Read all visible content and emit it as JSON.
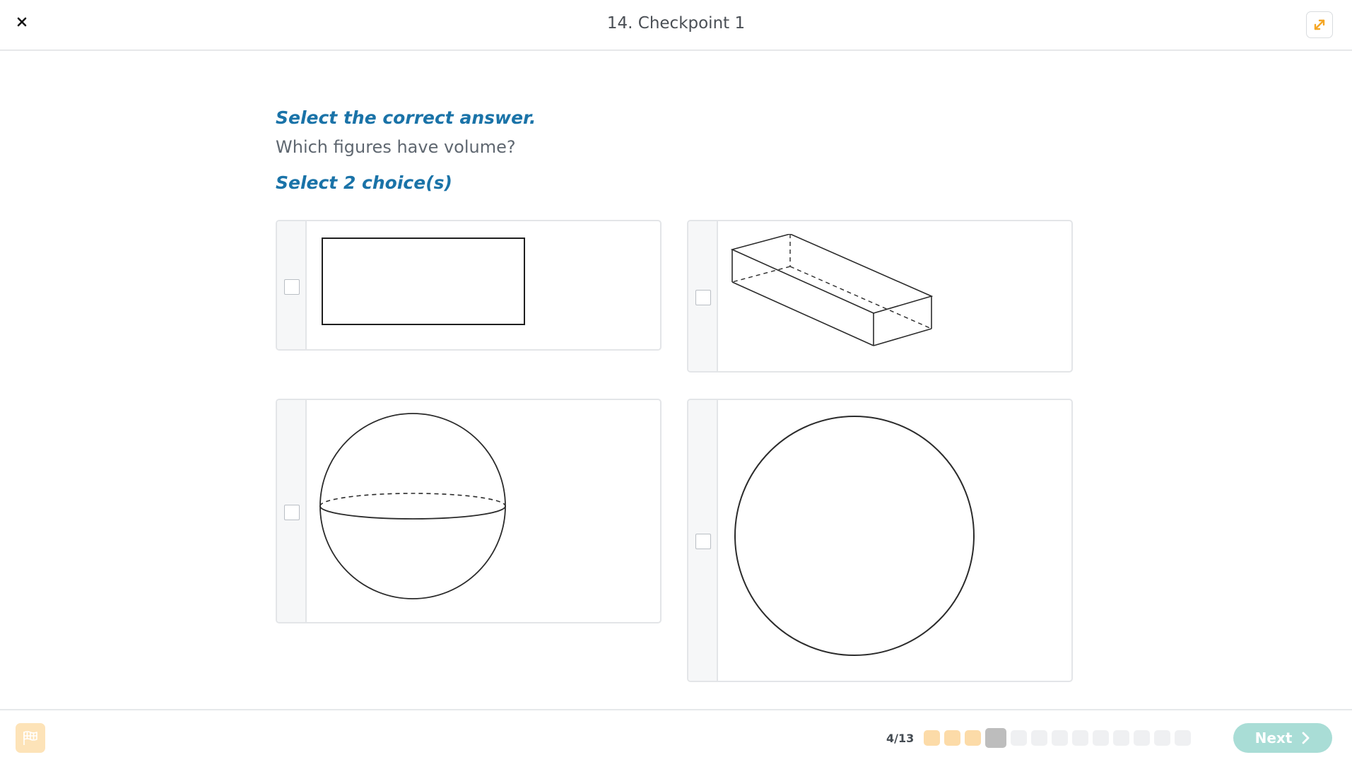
{
  "header": {
    "title": "14. Checkpoint 1",
    "close_icon": "close-icon",
    "expand_icon": "expand-icon",
    "accent_color": "#f5a623"
  },
  "question": {
    "instruction": "Select the correct answer.",
    "prompt": "Which figures have volume?",
    "select_count": "Select 2 choice(s)"
  },
  "choices": [
    {
      "figure": "rectangle",
      "checked": false
    },
    {
      "figure": "rectangular-prism",
      "checked": false
    },
    {
      "figure": "sphere",
      "checked": false
    },
    {
      "figure": "circle",
      "checked": false
    }
  ],
  "footer": {
    "flag_icon": "flag-icon",
    "progress": "4/13",
    "current_question": 4,
    "total_questions": 13,
    "next_label": "Next",
    "next_icon": "chevron-right-icon",
    "next_color": "#a9ddd6"
  }
}
